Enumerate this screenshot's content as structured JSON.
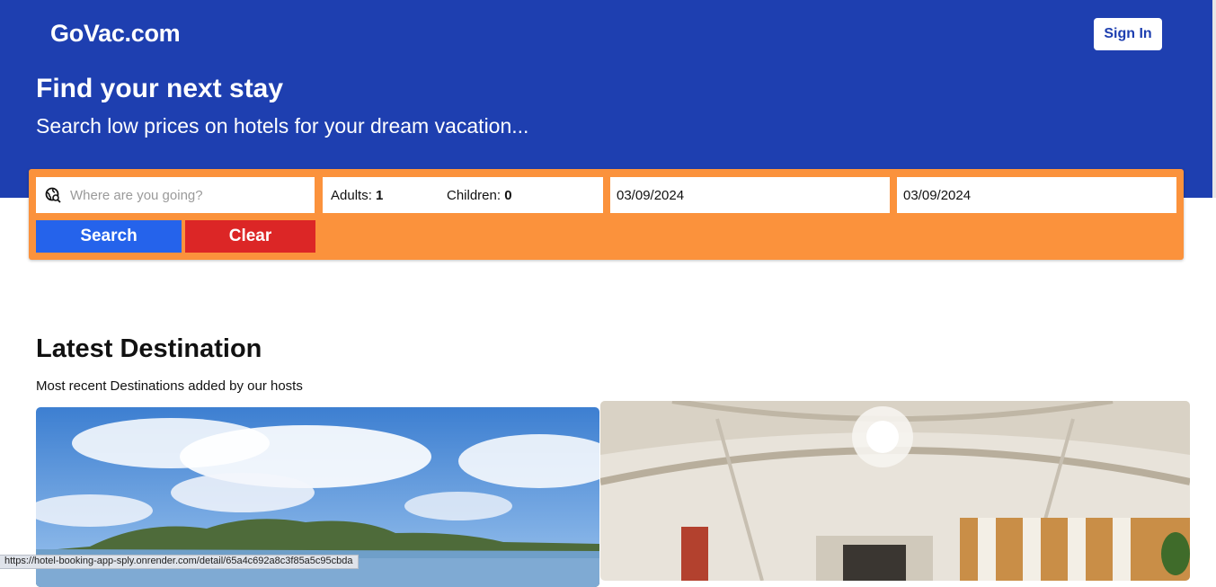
{
  "header": {
    "logo": "GoVac.com",
    "sign_in_label": "Sign In"
  },
  "hero": {
    "title": "Find your next stay",
    "subtitle": "Search low prices on hotels for your dream vacation..."
  },
  "search": {
    "destination_placeholder": "Where are you going?",
    "destination_value": "",
    "adults_label": "Adults:",
    "adults_value": "1",
    "children_label": "Children:",
    "children_value": "0",
    "check_in": "03/09/2024",
    "check_out": "03/09/2024",
    "search_label": "Search",
    "clear_label": "Clear"
  },
  "latest": {
    "title": "Latest Destination",
    "subtitle": "Most recent Destinations added by our hosts"
  },
  "status_bar": {
    "url": "https://hotel-booking-app-spl​y.onrender.com/detail/65a4c692a8c3f85a5c95cbda"
  },
  "colors": {
    "hero_blue": "#1e3fb0",
    "search_orange": "#fb923c",
    "search_button": "#2563eb",
    "clear_button": "#dc2626"
  },
  "icons": {
    "destination": "globe-search-icon"
  }
}
